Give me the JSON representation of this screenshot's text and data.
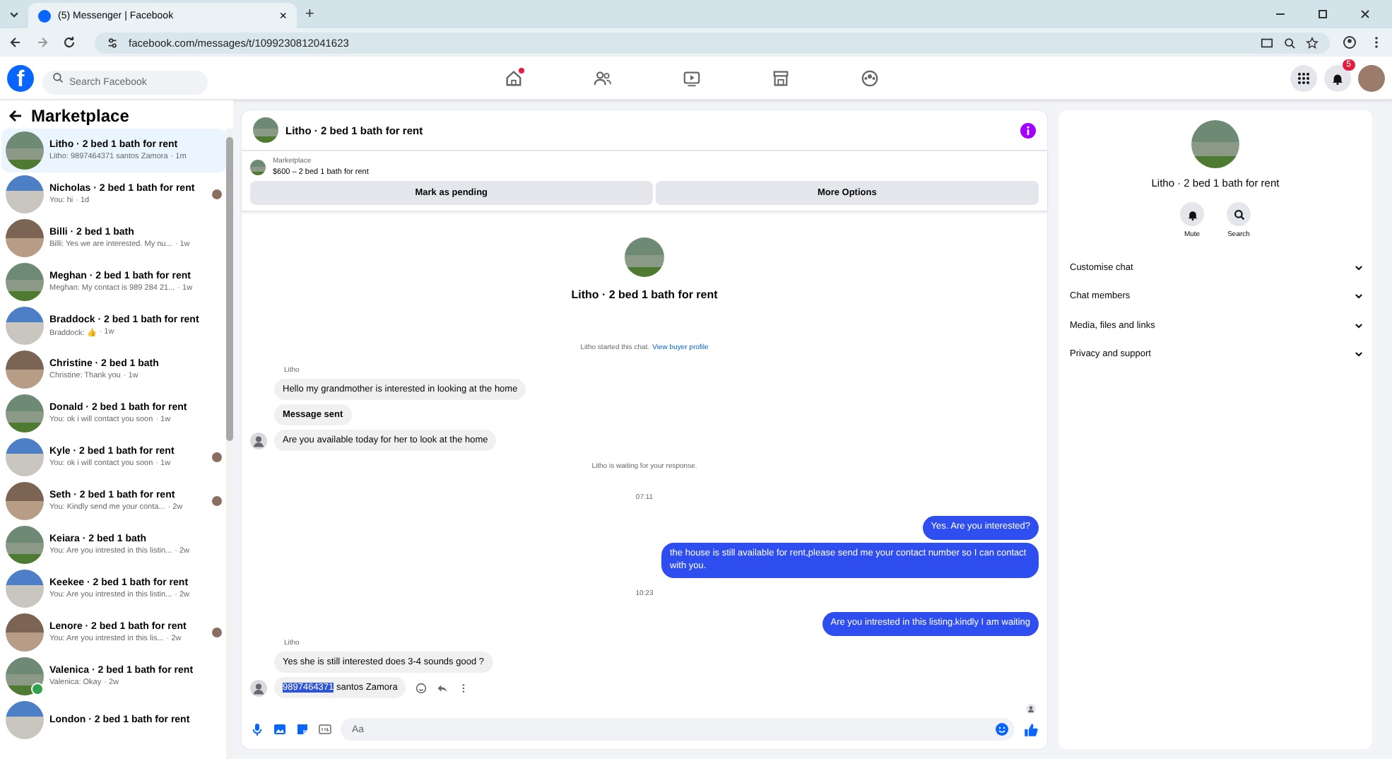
{
  "browser": {
    "tab_title": "(5) Messenger | Facebook",
    "tab_close": "×",
    "new_tab": "+",
    "url": "facebook.com/messages/t/1099230812041623"
  },
  "header": {
    "logo": "f",
    "search_placeholder": "Search Facebook",
    "nav": [
      {
        "kind": "home",
        "selected": false,
        "dot": true
      },
      {
        "kind": "friends",
        "selected": false,
        "dot": false
      },
      {
        "kind": "video",
        "selected": false,
        "dot": false
      },
      {
        "kind": "marketplace",
        "selected": false,
        "dot": false
      },
      {
        "kind": "groups",
        "selected": false,
        "dot": false
      }
    ],
    "notifications_badge": "5"
  },
  "sidebar": {
    "title": "Marketplace",
    "items": [
      {
        "title": "Litho · 2 bed 1 bath for rent",
        "preview": "Litho: 9897464371 santos Zamora",
        "time": "· 1m",
        "selected": true,
        "seen": false,
        "online": false
      },
      {
        "title": "Nicholas · 2 bed 1 bath for rent",
        "preview": "You: hi",
        "time": "· 1d",
        "selected": false,
        "seen": true,
        "online": false
      },
      {
        "title": "Billi · 2 bed 1 bath",
        "preview": "Billi: Yes we are interested. My nu...",
        "time": "· 1w",
        "selected": false,
        "seen": false,
        "online": false
      },
      {
        "title": "Meghan · 2 bed 1 bath for rent",
        "preview": "Meghan: My contact is 989 284 21...",
        "time": "· 1w",
        "selected": false,
        "seen": false,
        "online": false
      },
      {
        "title": "Braddock · 2 bed 1 bath for rent",
        "preview": "Braddock: 👍",
        "time": "· 1w",
        "selected": false,
        "seen": false,
        "online": false
      },
      {
        "title": "Christine · 2 bed 1 bath",
        "preview": "Christine: Thank you",
        "time": "· 1w",
        "selected": false,
        "seen": false,
        "online": false
      },
      {
        "title": "Donald · 2 bed 1 bath for rent",
        "preview": "You: ok i will contact you soon",
        "time": "· 1w",
        "selected": false,
        "seen": false,
        "online": false
      },
      {
        "title": "Kyle · 2 bed 1 bath for rent",
        "preview": "You: ok i will contact you soon",
        "time": "· 1w",
        "selected": false,
        "seen": true,
        "online": false
      },
      {
        "title": "Seth · 2 bed 1 bath for rent",
        "preview": "You: Kindly send me your conta...",
        "time": "· 2w",
        "selected": false,
        "seen": true,
        "online": false
      },
      {
        "title": "Keiara · 2 bed 1 bath",
        "preview": "You: Are you intrested in this listin...",
        "time": "· 2w",
        "selected": false,
        "seen": false,
        "online": false
      },
      {
        "title": "Keekee · 2 bed 1 bath for rent",
        "preview": "You: Are you intrested in this listin...",
        "time": "· 2w",
        "selected": false,
        "seen": false,
        "online": false
      },
      {
        "title": "Lenore · 2 bed 1 bath for rent",
        "preview": "You: Are you intrested in this lis...",
        "time": "· 2w",
        "selected": false,
        "seen": true,
        "online": false
      },
      {
        "title": "Valenica · 2 bed 1 bath for rent",
        "preview": "Valenica: Okay",
        "time": "· 2w",
        "selected": false,
        "seen": false,
        "online": true
      },
      {
        "title": "London · 2 bed 1 bath for rent",
        "selected": false,
        "seen": false,
        "online": false
      }
    ]
  },
  "chat": {
    "title": "Litho · 2 bed 1 bath for rent",
    "listing_label": "Marketplace",
    "listing_title": "$600 – 2 bed 1 bath for rent",
    "buttons": [
      "Mark as pending",
      "More Options"
    ],
    "intro_title": "Litho · 2 bed 1 bath for rent",
    "intro_text": "Litho started this chat.",
    "intro_link": "View buyer profile",
    "messages": [
      {
        "kind": "sender",
        "text": "Litho"
      },
      {
        "kind": "incoming",
        "text": "Hello my grandmother is interested in looking at the home",
        "bold": false,
        "avatar": false,
        "actions": false
      },
      {
        "kind": "incoming",
        "text": "Message sent",
        "bold": true,
        "avatar": false,
        "actions": false
      },
      {
        "kind": "incoming",
        "text": "Are you available today for her to look at the home",
        "bold": false,
        "avatar": true,
        "actions": false
      },
      {
        "kind": "system",
        "text": "Litho is waiting for your response."
      },
      {
        "kind": "time",
        "text": "07:11"
      },
      {
        "kind": "outgoing",
        "text": "Yes. Are you interested?"
      },
      {
        "kind": "outgoing",
        "text": "the house is still available for rent,please send me your contact number so I can contact with you."
      },
      {
        "kind": "time",
        "text": "10:23"
      },
      {
        "kind": "outgoing",
        "text": "Are you intrested in this listing.kindly I am waiting"
      },
      {
        "kind": "sender",
        "text": "Litho"
      },
      {
        "kind": "incoming",
        "text": "Yes she is still interested does 3-4 sounds good ?",
        "bold": false,
        "avatar": false,
        "actions": false
      },
      {
        "kind": "incoming",
        "highlight": "9897464371",
        "text": "santos Zamora",
        "bold": false,
        "avatar": true,
        "actions": true
      },
      {
        "kind": "receipt"
      }
    ],
    "composer_placeholder": "Aa"
  },
  "details": {
    "title": "Litho · 2 bed 1 bath for rent",
    "actions": [
      {
        "kind": "mute",
        "label": "Mute"
      },
      {
        "kind": "search",
        "label": "Search"
      }
    ],
    "sections": [
      "Customise chat",
      "Chat members",
      "Media, files and links",
      "Privacy and support"
    ]
  }
}
